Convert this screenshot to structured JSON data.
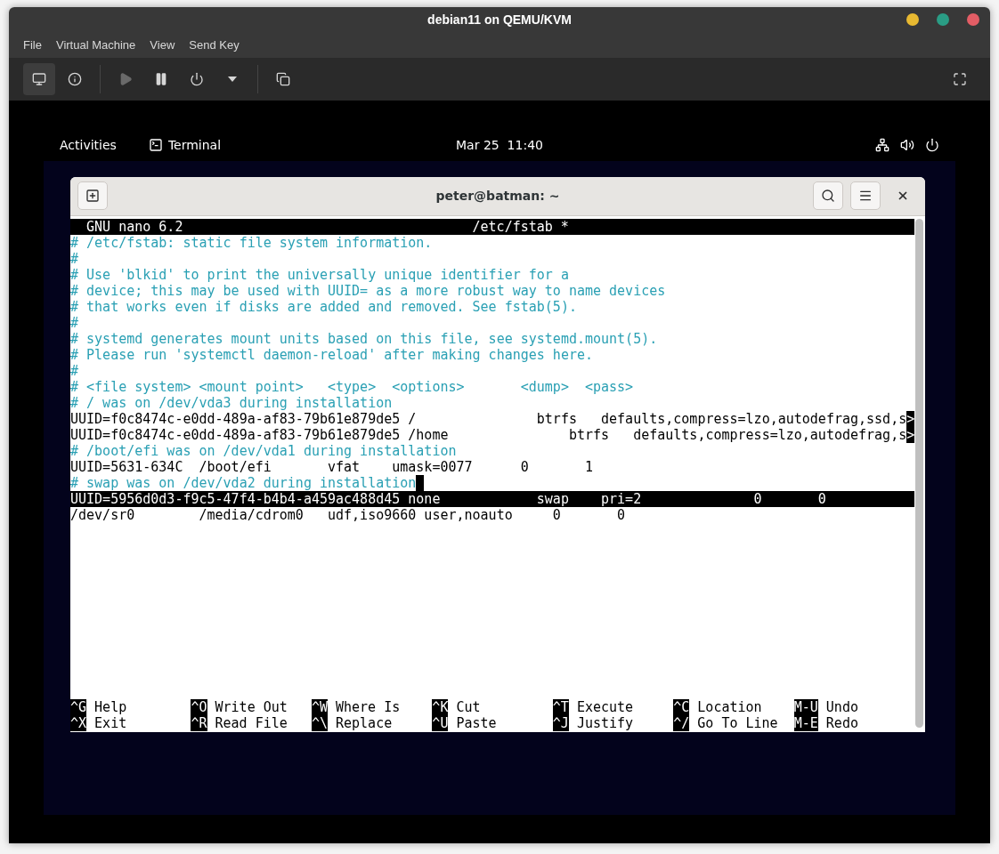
{
  "window": {
    "title": "debian11 on QEMU/KVM",
    "controls": [
      {
        "color": "#e8b931"
      },
      {
        "color": "#2a9d85"
      },
      {
        "color": "#e35d65"
      }
    ]
  },
  "menu": [
    "File",
    "Virtual Machine",
    "View",
    "Send Key"
  ],
  "toolbar": [
    {
      "kind": "console",
      "selected": true,
      "disabled": false
    },
    {
      "kind": "details",
      "selected": false,
      "disabled": false
    },
    {
      "kind": "separator"
    },
    {
      "kind": "run",
      "selected": false,
      "disabled": true
    },
    {
      "kind": "pause",
      "selected": false,
      "disabled": false
    },
    {
      "kind": "shutdown",
      "selected": false,
      "disabled": false
    },
    {
      "kind": "dropdown",
      "selected": false,
      "disabled": false
    },
    {
      "kind": "separator"
    },
    {
      "kind": "snapshots",
      "selected": false,
      "disabled": false
    },
    {
      "kind": "spacer"
    },
    {
      "kind": "fullscreen",
      "selected": false,
      "disabled": false
    }
  ],
  "guest": {
    "panel": {
      "activities": "Activities",
      "app": "Terminal",
      "clock": "Mar 25  11:40",
      "status_icons": [
        {
          "kind": "network"
        },
        {
          "kind": "volume"
        },
        {
          "kind": "power"
        }
      ]
    },
    "terminal": {
      "title": "peter@batman: ~",
      "nano": {
        "version": "GNU nano 6.2",
        "file": "/etc/fstab *",
        "lines": [
          {
            "text": "# /etc/fstab: static file system information.",
            "kind": "comment",
            "selected": false,
            "cursor": false
          },
          {
            "text": "#",
            "kind": "comment",
            "selected": false,
            "cursor": false
          },
          {
            "text": "# Use 'blkid' to print the universally unique identifier for a",
            "kind": "comment",
            "selected": false,
            "cursor": false
          },
          {
            "text": "# device; this may be used with UUID= as a more robust way to name devices",
            "kind": "comment",
            "selected": false,
            "cursor": false
          },
          {
            "text": "# that works even if disks are added and removed. See fstab(5).",
            "kind": "comment",
            "selected": false,
            "cursor": false
          },
          {
            "text": "#",
            "kind": "comment",
            "selected": false,
            "cursor": false
          },
          {
            "text": "# systemd generates mount units based on this file, see systemd.mount(5).",
            "kind": "comment",
            "selected": false,
            "cursor": false
          },
          {
            "text": "# Please run 'systemctl daemon-reload' after making changes here.",
            "kind": "comment",
            "selected": false,
            "cursor": false
          },
          {
            "text": "#",
            "kind": "comment",
            "selected": false,
            "cursor": false
          },
          {
            "text": "# <file system> <mount point>   <type>  <options>       <dump>  <pass>",
            "kind": "comment",
            "selected": false,
            "cursor": false
          },
          {
            "text": "# / was on /dev/vda3 during installation",
            "kind": "comment",
            "selected": false,
            "cursor": false
          },
          {
            "text": "UUID=f0c8474c-e0dd-489a-af83-79b61e879de5 /               btrfs   defaults,compress=lzo,autodefrag,ssd,s",
            "kind": "entry",
            "selected": false,
            "cursor": false,
            "overflow": ">"
          },
          {
            "text": "UUID=f0c8474c-e0dd-489a-af83-79b61e879de5 /home               btrfs   defaults,compress=lzo,autodefrag,s",
            "kind": "entry",
            "selected": false,
            "cursor": false,
            "overflow": ">"
          },
          {
            "text": "# /boot/efi was on /dev/vda1 during installation",
            "kind": "comment",
            "selected": false,
            "cursor": false
          },
          {
            "text": "UUID=5631-634C  /boot/efi       vfat    umask=0077      0       1",
            "kind": "entry",
            "selected": false,
            "cursor": false
          },
          {
            "text": "# swap was on /dev/vda2 during installation",
            "kind": "comment",
            "selected": false,
            "cursor": true
          },
          {
            "text": "UUID=5956d0d3-f9c5-47f4-b4b4-a459ac488d45 none            swap    pri=2              0       0",
            "kind": "entry",
            "selected": true,
            "cursor": false
          },
          {
            "text": "/dev/sr0        /media/cdrom0   udf,iso9660 user,noauto     0       0",
            "kind": "entry",
            "selected": false,
            "cursor": false
          }
        ],
        "shortcuts": [
          [
            {
              "key": "^G",
              "label": "Help"
            },
            {
              "key": "^O",
              "label": "Write Out"
            },
            {
              "key": "^W",
              "label": "Where Is"
            },
            {
              "key": "^K",
              "label": "Cut"
            },
            {
              "key": "^T",
              "label": "Execute"
            },
            {
              "key": "^C",
              "label": "Location"
            },
            {
              "key": "M-U",
              "label": "Undo"
            }
          ],
          [
            {
              "key": "^X",
              "label": "Exit"
            },
            {
              "key": "^R",
              "label": "Read File"
            },
            {
              "key": "^\\",
              "label": "Replace"
            },
            {
              "key": "^U",
              "label": "Paste"
            },
            {
              "key": "^J",
              "label": "Justify"
            },
            {
              "key": "^/",
              "label": "Go To Line"
            },
            {
              "key": "M-E",
              "label": "Redo"
            }
          ]
        ]
      }
    }
  }
}
